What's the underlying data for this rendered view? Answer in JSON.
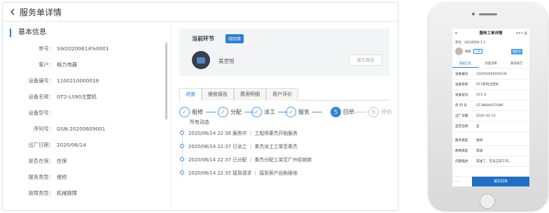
{
  "web": {
    "title": "服务单详情",
    "section": "基本信息",
    "fields": [
      {
        "k": "单号：",
        "v": "SW20200614%0001"
      },
      {
        "k": "客户：",
        "v": "格力电器"
      },
      {
        "k": "设备编号：",
        "v": "1100210000016"
      },
      {
        "k": "设备名称：",
        "v": "GT2-LS90注塑机"
      },
      {
        "k": "设备型号：",
        "v": ""
      },
      {
        "k": "序列号：",
        "v": "GSN-20200609001"
      },
      {
        "k": "出厂日期：",
        "v": "2020/06/14"
      },
      {
        "k": "是否在保：",
        "v": "在保"
      },
      {
        "k": "服务类型：",
        "v": "维修"
      },
      {
        "k": "故障类型：",
        "v": "机械故障"
      }
    ],
    "current": {
      "heading": "当前环节",
      "tag": "待回单",
      "name": "吴世恒",
      "button": "填写报告"
    },
    "tabs": [
      "进度",
      "维修报告",
      "费用明细",
      "用户评价"
    ],
    "steps": [
      {
        "label": "报修",
        "state": "done"
      },
      {
        "label": "分配",
        "state": "done"
      },
      {
        "label": "派工",
        "state": "done"
      },
      {
        "label": "服务",
        "state": "done"
      },
      {
        "label": "回单",
        "num": "5",
        "state": "active"
      },
      {
        "label": "评价",
        "num": "6",
        "state": "todo"
      }
    ],
    "dynamic_title": "所有动态",
    "events": [
      "2020/06/14 22:38 服务中 ｜ 工程师秦杰开始服务",
      "2020/06/14 22:37 已派工 ｜ 秦杰派工工单至秦杰",
      "2020/06/14 22:37 已分配 ｜ 秦杰分配工单至广州经销商",
      "2020/06/14 22:35 接到请求 ｜ 接到客户自助报修"
    ]
  },
  "phone": {
    "title": "服务工单详情",
    "order_no": "单号：10230554 1 2",
    "person": "林栋",
    "tag": "上级",
    "status": "服务中",
    "tabs": [
      "基础信息",
      "进度详情",
      "服务报告"
    ],
    "rows": [
      {
        "k": "设备编号",
        "v": "102063845056236"
      },
      {
        "k": "设备名称",
        "v": "GT2系列注塑机"
      },
      {
        "k": "设备型号",
        "v": "GT2–S"
      },
      {
        "k": "序 列 号",
        "v": "GT39684973589"
      },
      {
        "k": "出厂日期",
        "v": "2020–03–15"
      },
      {
        "k": "是否在保",
        "v": "是"
      },
      {
        "k": "服务类型",
        "v": "维修"
      },
      {
        "k": "故障类型",
        "v": "漏油"
      },
      {
        "k": "问题描述",
        "v": "漏油了，无法正常工作。"
      }
    ],
    "more": "···",
    "button": "填写回单"
  },
  "colors": {
    "accent": "#1f80e0",
    "button": "#1f6fc6"
  }
}
